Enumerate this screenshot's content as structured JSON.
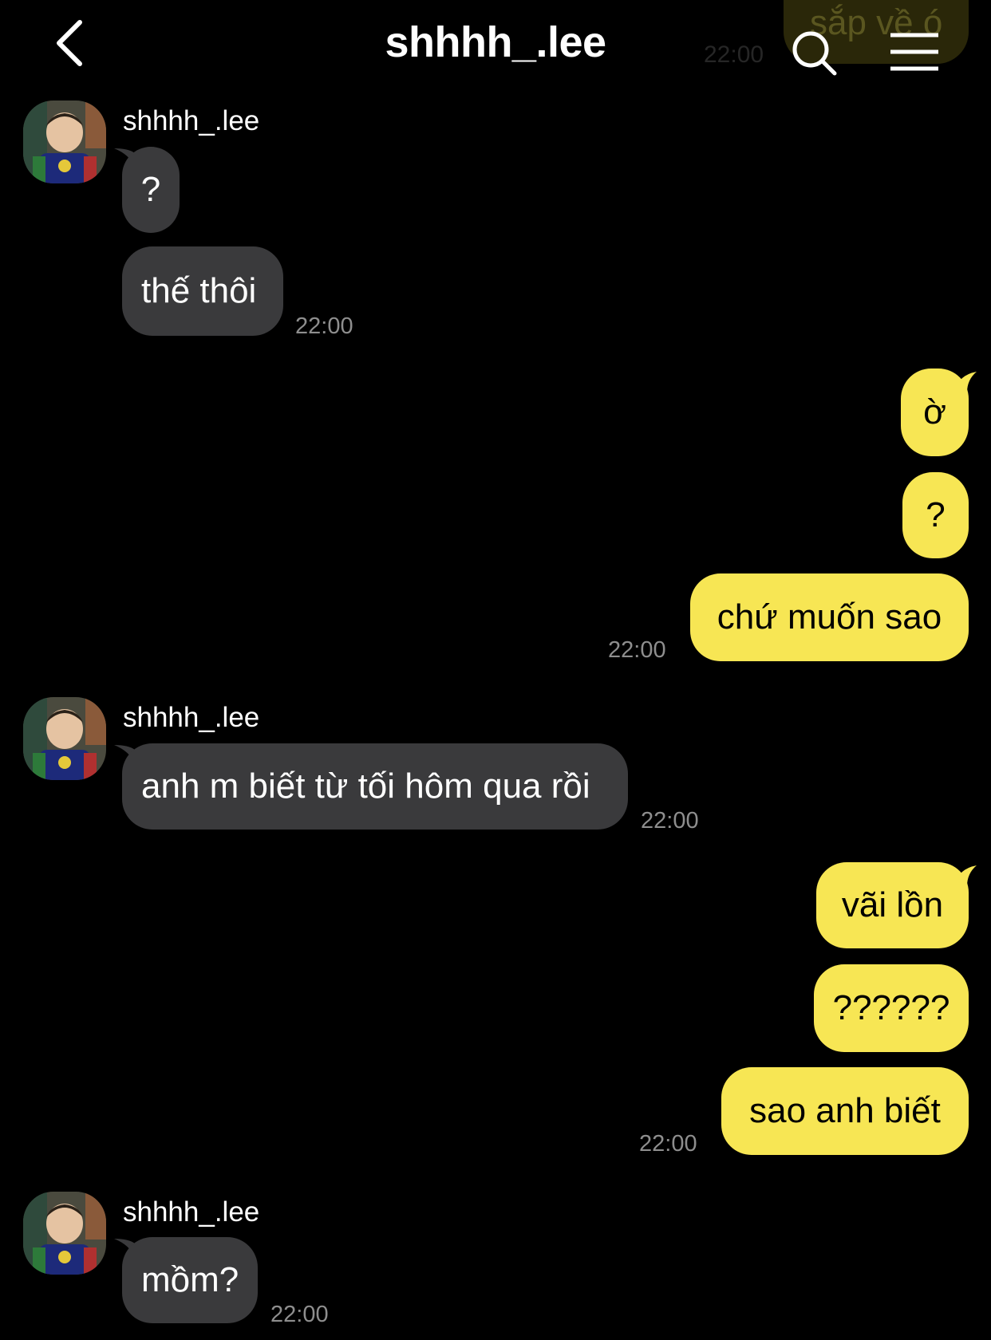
{
  "header": {
    "title": "shhhh_.lee",
    "ghost_message": "sắp về ó",
    "ghost_time": "22:00"
  },
  "messages": [
    {
      "sender": "shhhh_.lee",
      "text": "?"
    },
    {
      "text": "thế thôi",
      "time": "22:00"
    },
    {
      "text": "ờ"
    },
    {
      "text": "?"
    },
    {
      "text": "chứ muốn sao",
      "time": "22:00"
    },
    {
      "sender": "shhhh_.lee",
      "text": "anh m biết từ tối hôm qua rồi",
      "time": "22:00"
    },
    {
      "text": "vãi lồn"
    },
    {
      "text": "??????"
    },
    {
      "text": "sao anh biết",
      "time": "22:00"
    },
    {
      "sender": "shhhh_.lee",
      "text": "mồm?",
      "time": "22:00"
    }
  ],
  "colors": {
    "background": "#000000",
    "incoming_bubble": "#3a3a3c",
    "outgoing_bubble": "#f7e654",
    "timestamp": "#8e8e8e"
  },
  "icons": [
    "back-chevron-icon",
    "search-icon",
    "menu-icon"
  ]
}
